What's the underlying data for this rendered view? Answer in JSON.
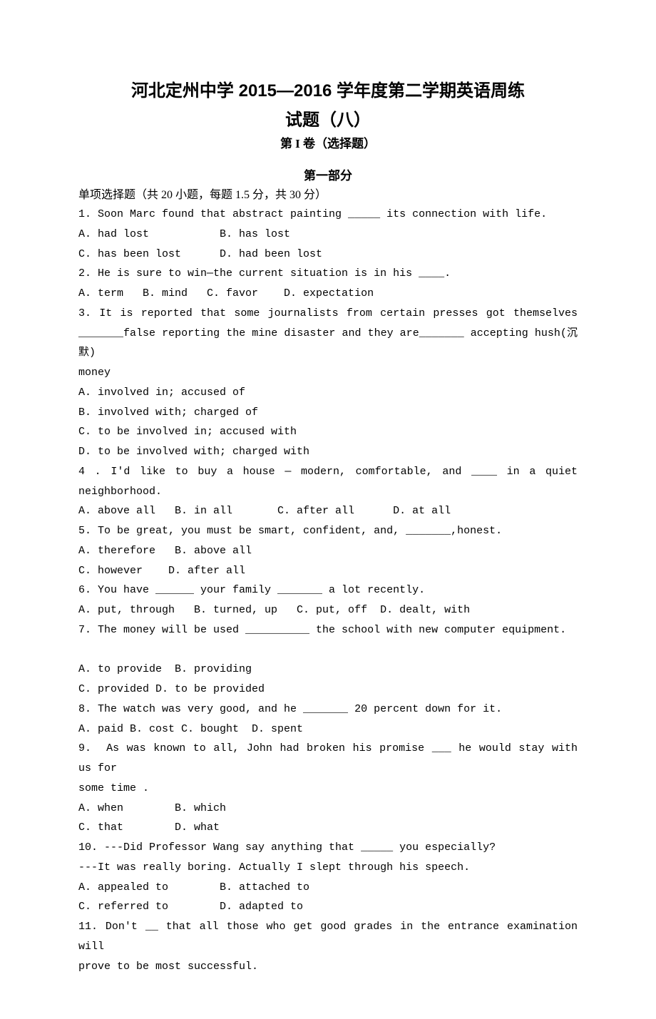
{
  "header": {
    "title_line1": "河北定州中学 2015—2016 学年度第二学期英语周练",
    "title_line2": "试题（八）",
    "volume": "第 I 卷（选择题）",
    "section": "第一部分",
    "instruction": "单项选择题（共 20 小题，每题 1.5 分，共 30 分）"
  },
  "questions": {
    "q1": {
      "stem": "1. Soon Marc found that abstract painting _____ its connection with life.",
      "opts_l1": "A. had lost           B. has lost",
      "opts_l2": "C. has been lost      D. had been lost"
    },
    "q2": {
      "stem": "2. He is sure to win—the current situation is in his ____.",
      "opts": "A. term   B. mind   C. favor    D. expectation"
    },
    "q3": {
      "stem_l1": "3. It is reported that some journalists from certain presses got themselves",
      "stem_l2": "_______false reporting the mine disaster and they are_______ accepting hush(沉默)",
      "stem_l3": "money",
      "optA": "A. involved in; accused of",
      "optB": "B. involved with; charged of",
      "optC": "C. to be involved in; accused with",
      "optD": "D. to be involved with; charged with"
    },
    "q4": {
      "stem_l1": "4 . I'd like to buy a house — modern, comfortable, and ____ in a quiet",
      "stem_l2": "neighborhood.",
      "opts": "A. above all   B. in all       C. after all      D. at all"
    },
    "q5": {
      "stem": "5. To be great, you must be smart, confident, and, _______,honest.",
      "opts_l1": "A. therefore   B. above all",
      "opts_l2": "C. however    D. after all"
    },
    "q6": {
      "stem": "6. You have ______ your family _______ a lot recently.",
      "opts": "A. put, through   B. turned, up   C. put, off  D. dealt, with"
    },
    "q7": {
      "stem": "7. The money will be used __________ the school with new computer equipment.",
      "opts_l1": "A. to provide  B. providing",
      "opts_l2": "C. provided D. to be provided"
    },
    "q8": {
      "stem": "8. The watch was very good, and he _______ 20 percent down for it.",
      "opts": "A. paid B. cost C. bought  D. spent"
    },
    "q9": {
      "stem_l1": "9.  As was known to all, John had broken his promise ___ he would stay with us for",
      "stem_l2": "some time .",
      "opts_l1": "A. when        B. which",
      "opts_l2": "C. that        D. what"
    },
    "q10": {
      "stem_l1": "10. ---Did Professor Wang say anything that _____ you especially?",
      "stem_l2": "---It was really boring. Actually I slept through his speech.",
      "opts_l1": "A. appealed to        B. attached to",
      "opts_l2": "C. referred to        D. adapted to"
    },
    "q11": {
      "stem_l1": "11. Don't __ that all those who get good grades in the entrance examination will",
      "stem_l2": "prove to be most successful."
    }
  }
}
